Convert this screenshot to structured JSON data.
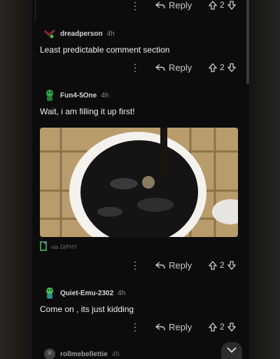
{
  "actions": {
    "reply_label": "Reply",
    "more_label": "⋮"
  },
  "top_row": {
    "score": "2"
  },
  "comments": [
    {
      "username": "dreadperson",
      "age": "4h",
      "text": "Least predictable comment section",
      "score": "2"
    },
    {
      "username": "Fun4-5One",
      "age": "4h",
      "text": "Wait, i am filling it up first!",
      "gif_source": "via GIPHY",
      "score": "2"
    },
    {
      "username": "Quiet-Emu-2302",
      "age": "4h",
      "text": "Come on , its just kidding",
      "score": "2"
    },
    {
      "username": "rollmebellettie",
      "age": "4h"
    }
  ],
  "icons": {
    "reply": "reply-arrow-icon",
    "upvote": "upvote-arrow-icon",
    "downvote": "downvote-arrow-icon",
    "more": "more-vertical-icon",
    "scroll_down": "chevron-down-icon"
  },
  "colors": {
    "background": "#0c0c0d",
    "text": "#f0f0f0",
    "meta": "#8a8a8a",
    "accent_green": "#3fbf5a"
  }
}
